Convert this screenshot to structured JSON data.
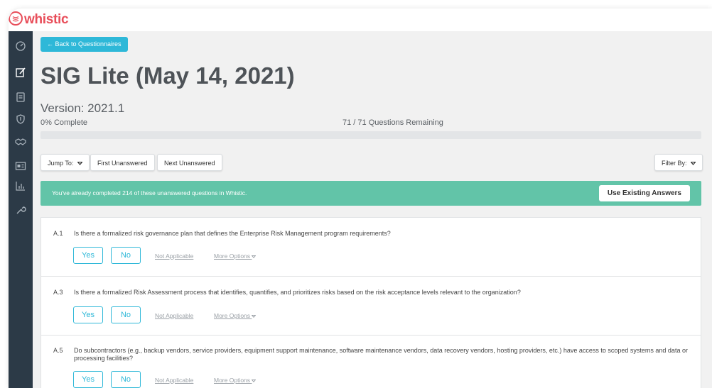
{
  "app": {
    "brand": "whistic"
  },
  "sidebar": {
    "icons": [
      "dashboard-icon",
      "edit-icon",
      "clipboard-icon",
      "shield-icon",
      "handshake-icon",
      "profile-card-icon",
      "bar-chart-icon",
      "wrench-icon"
    ]
  },
  "header": {
    "back_label": "← Back to Questionnaires",
    "title": "SIG Lite (May 14, 2021)",
    "version": "Version: 2021.1",
    "complete": "0% Complete",
    "remaining": "71 / 71 Questions Remaining",
    "progress_fraction": 0
  },
  "toolbar": {
    "jump_to": "Jump To:",
    "first_unanswered": "First Unanswered",
    "next_unanswered": "Next Unanswered",
    "filter_by": "Filter By:"
  },
  "banner": {
    "text": "You've already completed 214 of these unanswered questions in Whistic.",
    "use_existing": "Use Existing Answers"
  },
  "answer_options": {
    "yes": "Yes",
    "no": "No",
    "not_applicable": "Not Applicable",
    "more_options": "More Options"
  },
  "questions": [
    {
      "id": "A.1",
      "text": "Is there a formalized risk governance plan that defines the Enterprise Risk Management program requirements?"
    },
    {
      "id": "A.3",
      "text": "Is there a formalized Risk Assessment process that identifies, quantifies, and prioritizes risks based on the risk acceptance levels relevant to the organization?"
    },
    {
      "id": "A.5",
      "text": "Do subcontractors (e.g., backup vendors, service providers, equipment support maintenance, software maintenance vendors, data recovery vendors, hosting providers, etc.) have access to scoped systems and data or processing facilities?"
    }
  ],
  "colors": {
    "accent": "#2eb8d8",
    "banner": "#62c4a8",
    "brand": "#e84e5a",
    "sidebar": "#2c3a47"
  }
}
